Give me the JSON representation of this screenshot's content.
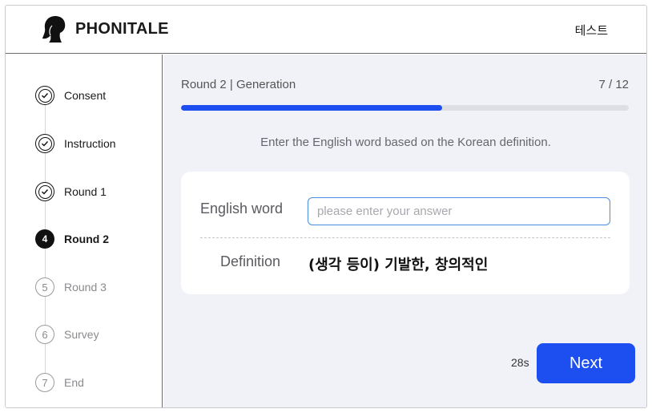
{
  "header": {
    "logo_icon": "woman-silhouette-icon",
    "brand": "PHONITALE",
    "user_name": "테스트"
  },
  "sidebar": {
    "steps": [
      {
        "label": "Consent",
        "state": "done",
        "icon": "check-circle-icon"
      },
      {
        "label": "Instruction",
        "state": "done",
        "icon": "check-circle-icon"
      },
      {
        "label": "Round 1",
        "state": "done",
        "icon": "check-circle-icon"
      },
      {
        "label": "Round 2",
        "state": "current",
        "number": "4"
      },
      {
        "label": "Round 3",
        "state": "pending",
        "number": "5"
      },
      {
        "label": "Survey",
        "state": "pending",
        "number": "6"
      },
      {
        "label": "End",
        "state": "pending",
        "number": "7"
      }
    ]
  },
  "main": {
    "round_title": "Round 2 | Generation",
    "progress": {
      "current": 7,
      "total": 12,
      "text": "7 / 12",
      "fill_fraction": 0.583
    },
    "instruction": "Enter the English word based on the Korean definition.",
    "card": {
      "field_label": "English word",
      "input_value": "",
      "input_placeholder": "please enter your answer",
      "definition_label": "Definition",
      "definition_value": "(생각 등이) 기발한, 창의적인"
    },
    "timer": "28s",
    "next_label": "Next"
  },
  "colors": {
    "accent": "#1d4ff0",
    "main_bg": "#f1f1f8",
    "input_border": "#4a8de0"
  }
}
